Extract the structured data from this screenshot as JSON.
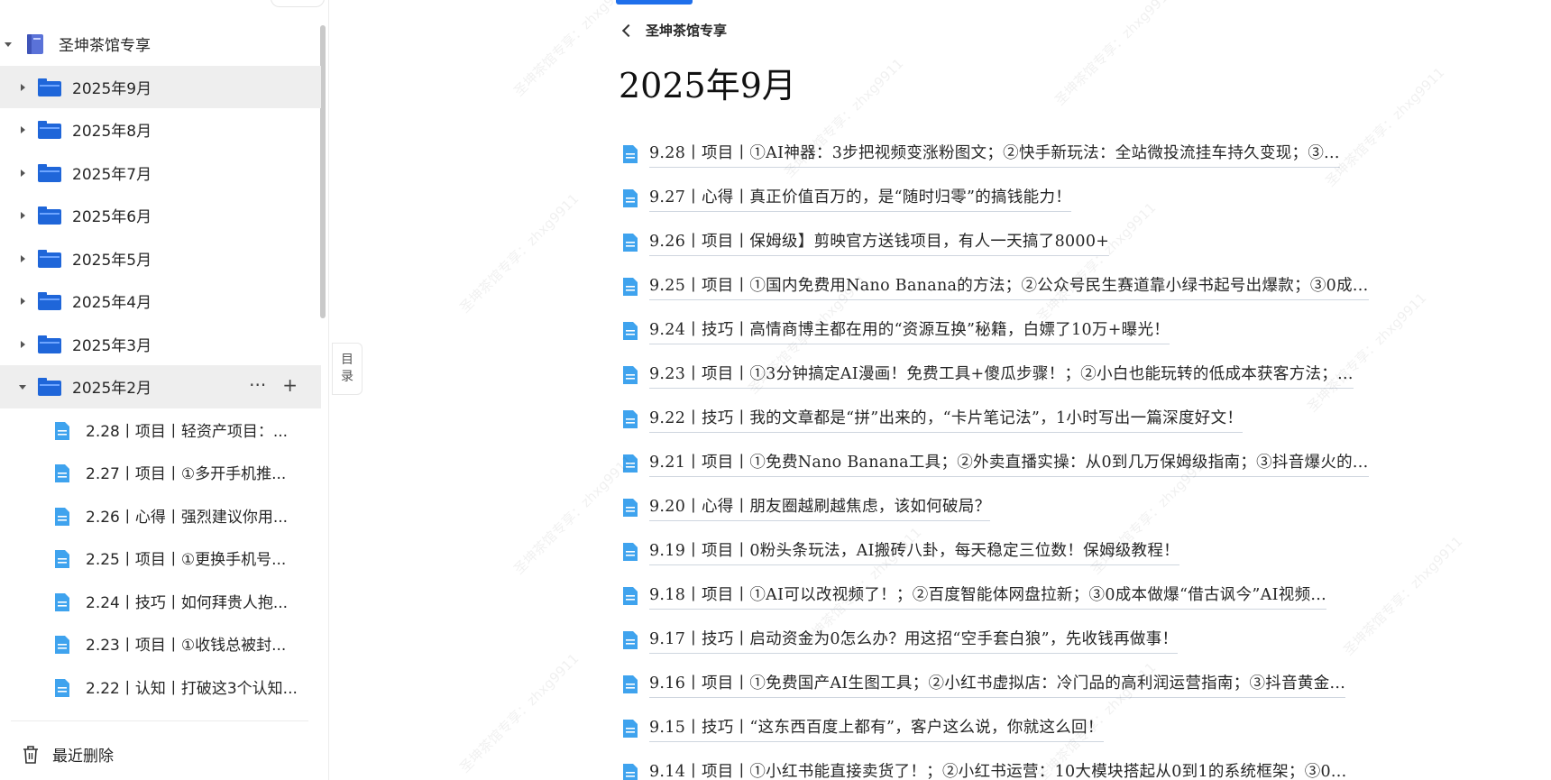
{
  "sidebar": {
    "root": {
      "label": "圣坤茶馆专享",
      "icon": "book-icon"
    },
    "folders": [
      {
        "label": "2025年9月",
        "expanded": false,
        "active": true
      },
      {
        "label": "2025年8月",
        "expanded": false
      },
      {
        "label": "2025年7月",
        "expanded": false
      },
      {
        "label": "2025年6月",
        "expanded": false
      },
      {
        "label": "2025年5月",
        "expanded": false
      },
      {
        "label": "2025年4月",
        "expanded": false
      },
      {
        "label": "2025年3月",
        "expanded": false
      },
      {
        "label": "2025年2月",
        "expanded": true,
        "actions": [
          "···",
          "+"
        ]
      }
    ],
    "subdocs": [
      "2.28丨项目丨轻资产项目：...",
      "2.27丨项目丨①多开手机推...",
      "2.26丨心得丨强烈建议你用...",
      "2.25丨项目丨①更换手机号...",
      "2.24丨技巧丨如何拜贵人抱...",
      "2.23丨项目丨①收钱总被封...",
      "2.22丨认知丨打破这3个认知..."
    ],
    "trash_label": "最近删除"
  },
  "toc_toggle": {
    "line1": "目",
    "line2": "录"
  },
  "main": {
    "back_label": "圣坤茶馆专享",
    "title": "2025年9月",
    "docs": [
      "9.28丨项目丨①AI神器：3步把视频变涨粉图文；②快手新玩法：全站微投流挂车持久变现；③...",
      "9.27丨心得丨真正价值百万的，是“随时归零”的搞钱能力！",
      "9.26丨项目丨保姆级】剪映官方送钱项目，有人一天搞了8000+",
      "9.25丨项目丨①国内免费用Nano Banana的方法；②公众号民生赛道靠小绿书起号出爆款；③0成...",
      "9.24丨技巧丨高情商博主都在用的“资源互换”秘籍，白嫖了10万+曝光！",
      "9.23丨项目丨①3分钟搞定AI漫画！免费工具+傻瓜步骤！；②小白也能玩转的低成本获客方法；...",
      "9.22丨技巧丨我的文章都是“拼”出来的，“卡片笔记法”，1小时写出一篇深度好文！",
      "9.21丨项目丨①免费Nano Banana工具；②外卖直播实操：从0到几万保姆级指南；③抖音爆火的...",
      "9.20丨心得丨朋友圈越刷越焦虑，该如何破局？",
      "9.19丨项目丨0粉头条玩法，AI搬砖八卦，每天稳定三位数！保姆级教程！",
      "9.18丨项目丨①AI可以改视频了！；②百度智能体网盘拉新；③0成本做爆“借古讽今”AI视频...",
      "9.17丨技巧丨启动资金为0怎么办？用这招“空手套白狼”，先收钱再做事！",
      "9.16丨项目丨①免费国产AI生图工具；②小红书虚拟店：冷门品的高利润运营指南；③抖音黄金...",
      "9.15丨技巧丨“这东西百度上都有”，客户这么说，你就这么回！",
      "9.14丨项目丨①小红书能直接卖货了！；②小红书运营：10大模块搭起从0到1的系统框架；③0..."
    ]
  },
  "watermark": "圣坤茶馆专享：zhxg9911",
  "colors": {
    "accent": "#1f6feb",
    "doc_icon": "#3fa3ee",
    "folder_icon": "#1f66d9"
  }
}
